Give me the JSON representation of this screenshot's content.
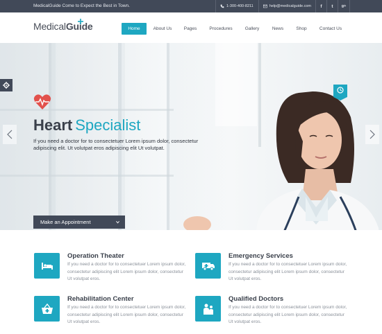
{
  "topbar": {
    "tagline": "MedicalGuide Come to Expect the Best in Town.",
    "phone": "1-300-400-8211",
    "email": "help@medicalguide.com",
    "social": [
      "f",
      "t",
      "g+"
    ]
  },
  "header": {
    "logo_part1": "Medical",
    "logo_part2": "Guide",
    "nav": [
      "Home",
      "About Us",
      "Pages",
      "Procedures",
      "Gallery",
      "News",
      "Shop",
      "Contact Us"
    ],
    "active_nav": "Home"
  },
  "hero": {
    "title_bold": "Heart",
    "title_light": "Specialist",
    "text": "If you need a doctor for to consectetuer Lorem ipsum dolor, consectetur adipiscing elit. Ut volutpat eros adipiscing elit Ut volutpat.",
    "appointment_label": "Make an Appointment"
  },
  "services": [
    {
      "title": "Operation Theater",
      "desc": "If you need a doctor for to consectetuer Lorem ipsum dolor, consectetur adipiscing elit Lorem ipsum dolor, consectetur Ut volutpat eros.",
      "icon": "bed-icon"
    },
    {
      "title": "Emergency Services",
      "desc": "If you need a doctor for to consectetuer Lorem ipsum dolor, consectetur adipiscing elit Lorem ipsum dolor, consectetur Ut volutpat eros.",
      "icon": "ambulance-icon"
    },
    {
      "title": "Rehabilitation Center",
      "desc": "If you need a doctor for to consectetuer Lorem ipsum dolor, consectetur adipiscing elit Lorem ipsum dolor, consectetur Ut volutpat eros.",
      "icon": "basket-icon"
    },
    {
      "title": "Qualified Doctors",
      "desc": "If you need a doctor for to consectetuer Lorem ipsum dolor, consectetur adipiscing elit Lorem ipsum dolor, consectetur Ut volutpat eros.",
      "icon": "doctors-icon"
    }
  ],
  "colors": {
    "accent": "#1ea7c1",
    "dark": "#414958",
    "heart": "#e2514c"
  }
}
